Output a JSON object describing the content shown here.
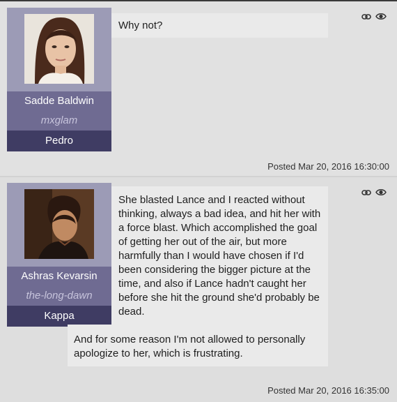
{
  "posts": [
    {
      "author_name": "Sadde Baldwin",
      "username": "mxglam",
      "character": "Pedro",
      "message_paragraphs": [
        "Why not?"
      ],
      "posted_label": "Posted",
      "timestamp": "Mar 20, 2016 16:30:00",
      "icons": [
        "link-icon",
        "eye-icon"
      ]
    },
    {
      "author_name": "Ashras Kevarsin",
      "username": "the-long-dawn",
      "character": "Kappa",
      "message_paragraphs": [
        "She blasted Lance and I reacted without thinking, always a bad idea, and hit her with a force blast. Which accomplished the goal of getting her out of the air, but more harmfully than I would have chosen if I'd been considering the bigger picture at the time, and also if Lance hadn't caught her before she hit the ground she'd probably be dead.",
        "And for some reason I'm not allowed to personally apologize to her, which is frustrating."
      ],
      "posted_label": "Posted",
      "timestamp": "Mar 20, 2016 16:35:00",
      "icons": [
        "link-icon",
        "eye-icon"
      ]
    }
  ],
  "colors": {
    "profile_bg": "#9c9bb6",
    "name_bg": "#6f6b92",
    "character_bg": "#3f3c63",
    "bubble_bg": "#eaeaea"
  }
}
